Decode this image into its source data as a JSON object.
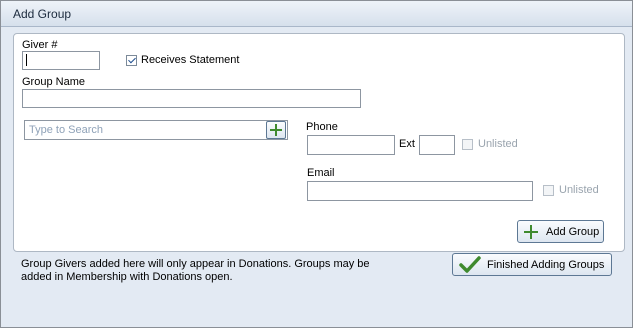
{
  "window": {
    "title": "Add Group"
  },
  "form": {
    "giver_label": "Giver #",
    "giver_value": "",
    "receives_statement_label": "Receives Statement",
    "receives_statement_checked": true,
    "group_name_label": "Group Name",
    "group_name_value": "",
    "search_placeholder": "Type to Search",
    "phone_label": "Phone",
    "phone_value": "",
    "ext_label": "Ext",
    "ext_value": "",
    "phone_unlisted_label": "Unlisted",
    "email_label": "Email",
    "email_value": "",
    "email_unlisted_label": "Unlisted",
    "add_group_button": "Add Group"
  },
  "footer": {
    "note": "Group Givers added here will only appear in Donations.  Groups may be added in Membership with Donations open.",
    "finished_button": "Finished Adding Groups"
  },
  "colors": {
    "accent_green": "#3f8a2e",
    "checkmark_blue": "#1d4e8f",
    "search_placeholder": "#8fa2b8"
  },
  "icons": {
    "add": "plus-icon",
    "finish": "checkmark-icon"
  }
}
